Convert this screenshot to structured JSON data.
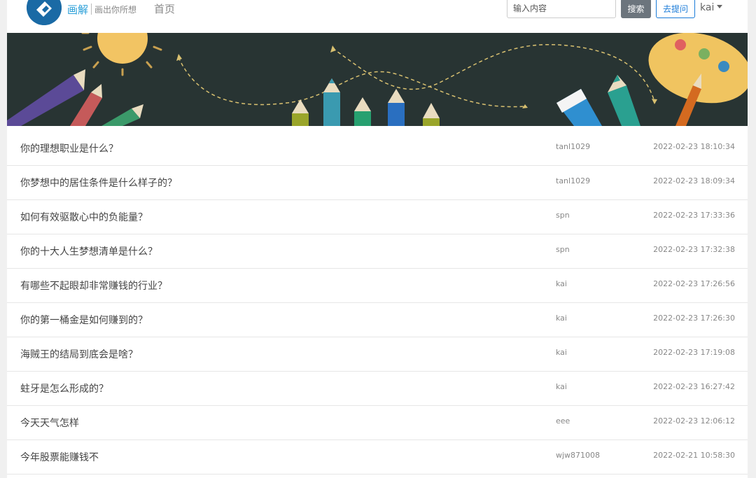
{
  "header": {
    "brand": "画解",
    "tagline": "画出你所想",
    "nav_home": "首页",
    "search_placeholder": "输入内容",
    "search_button": "搜索",
    "ask_button": "去提问",
    "user": "kai"
  },
  "colors": {
    "brand": "#2a9fd8",
    "banner_bg": "#283433",
    "ask_outline": "#1a7bd8",
    "search_button_bg": "#6c757d"
  },
  "questions": [
    {
      "title": "你的理想职业是什么？",
      "author": "tanl1029",
      "time": "2022-02-23 18:10:34"
    },
    {
      "title": "你梦想中的居住条件是什么样子的？",
      "author": "tanl1029",
      "time": "2022-02-23 18:09:34"
    },
    {
      "title": "如何有效驱散心中的负能量？",
      "author": "spn",
      "time": "2022-02-23 17:33:36"
    },
    {
      "title": "你的十大人生梦想清单是什么？",
      "author": "spn",
      "time": "2022-02-23 17:32:38"
    },
    {
      "title": "有哪些不起眼却非常赚钱的行业？",
      "author": "kai",
      "time": "2022-02-23 17:26:56"
    },
    {
      "title": "你的第一桶金是如何赚到的？",
      "author": "kai",
      "time": "2022-02-23 17:26:30"
    },
    {
      "title": "海贼王的结局到底会是啥？",
      "author": "kai",
      "time": "2022-02-23 17:19:08"
    },
    {
      "title": "蛀牙是怎么形成的？",
      "author": "kai",
      "time": "2022-02-23 16:27:42"
    },
    {
      "title": "今天天气怎样",
      "author": "eee",
      "time": "2022-02-23 12:06:12"
    },
    {
      "title": "今年股票能赚钱不",
      "author": "wjw871008",
      "time": "2022-02-21 10:58:30"
    }
  ]
}
